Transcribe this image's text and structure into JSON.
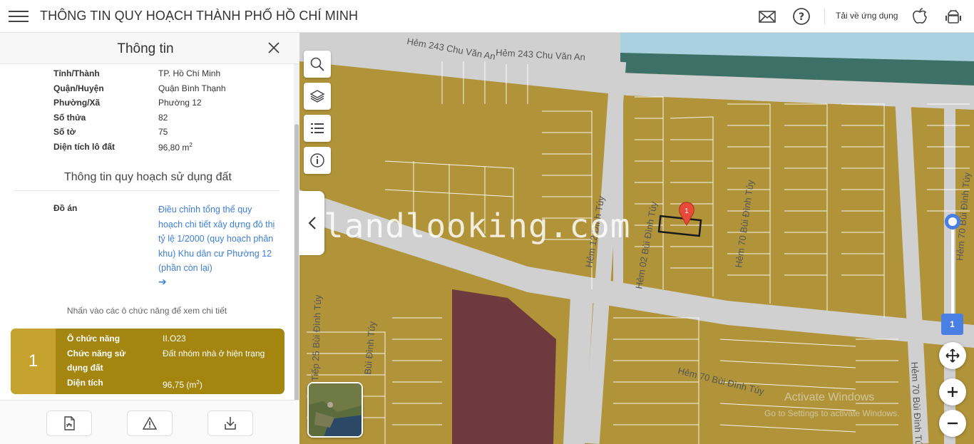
{
  "header": {
    "title": "THÔNG TIN QUY HOẠCH THÀNH PHỐ HỒ CHÍ MINH",
    "download_label": "Tải về ứng dụng"
  },
  "sidebar": {
    "title": "Thông tin",
    "info": [
      {
        "label": "Tỉnh/Thành",
        "value": "TP. Hồ Chí Minh"
      },
      {
        "label": "Quận/Huyện",
        "value": "Quận Bình Thạnh"
      },
      {
        "label": "Phường/Xã",
        "value": "Phường 12"
      },
      {
        "label": "Số thửa",
        "value": "82"
      },
      {
        "label": "Số tờ",
        "value": "75"
      },
      {
        "label": "Diện tích lô đất",
        "value": "96,80 m",
        "sup": "2"
      }
    ],
    "plan_heading": "Thông tin quy hoạch sử dụng đất",
    "project_label": "Đồ án",
    "project_link": "Điều chỉnh tổng thể quy hoạch chi tiết xây dựng đô thị tỷ lệ 1/2000 (quy hoạch phân khu) Khu dân cư Phường 12 (phần còn lại)",
    "hint": "Nhấn vào các ô chức năng để xem chi tiết",
    "function_card": {
      "number": "1",
      "rows": [
        {
          "label": "Ô chức năng",
          "value": "II.O23"
        },
        {
          "label": "Chức năng sử dụng đất",
          "value": "Đất nhóm nhà ở hiện trạng"
        },
        {
          "label": "Diện tích",
          "value": "96,75 (m",
          "sup": "2",
          "suffix": ")"
        }
      ]
    }
  },
  "map": {
    "watermark": "landlooking.com",
    "street_labels": [
      "Hẻm 243 Chu Văn An",
      "Hẻm 243 Chu Văn An",
      "Hẻm 70 Bùi Đình Túy",
      "Hẻm 12 Đình Túy",
      "Hẻm 02 Bùi Đình Túy",
      "Hẻm 70 Bùi Đình Túy",
      "Hẻm 70 Bùi Đình Túy",
      "Hẻm Tiếp 25 Bùi Đình Túy",
      "Bùi Đình Túy",
      "Hẻm 70 Bùi Đình Túy"
    ],
    "marker_label": "1",
    "layer_badge": "1",
    "overlay_line1": "Activate Windows",
    "overlay_line2": "Go to Settings to activate Windows."
  },
  "colors": {
    "land_residential": "#b1943a",
    "land_public": "#6e3a3d",
    "river": "#3d7066",
    "road": "#d0d0d0",
    "accent_blue": "#4a7fe3",
    "card_dark": "#a3850f",
    "card_light": "#c4a22d"
  }
}
